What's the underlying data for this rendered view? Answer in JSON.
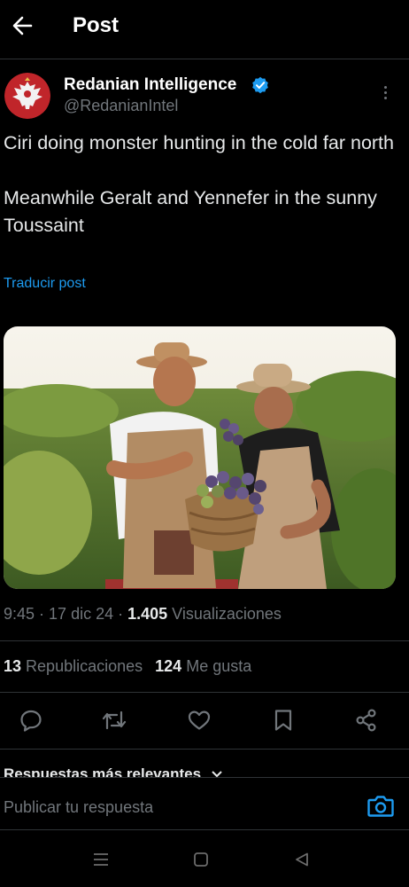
{
  "header": {
    "title": "Post",
    "back_icon": "arrow-left-icon"
  },
  "author": {
    "display_name": "Redanian Intelligence",
    "handle": "@RedanianIntel",
    "verified": true,
    "verified_color": "#1d9bf0",
    "avatar_icon": "eagle-crest-icon"
  },
  "post": {
    "paragraphs": [
      "Ciri doing monster hunting in the cold far north",
      "Meanwhile Geralt and Yennefer in the sunny Toussaint"
    ],
    "translate_label": "Traducir post",
    "image_icon": "photo-couple-with-grapes"
  },
  "meta": {
    "time": "9:45",
    "date": "17 dic 24",
    "views_count": "1.405",
    "views_label": "Visualizaciones"
  },
  "stats": {
    "reposts_count": "13",
    "reposts_label": "Republicaciones",
    "likes_count": "124",
    "likes_label": "Me gusta"
  },
  "actions": [
    "reply-icon",
    "repost-icon",
    "like-icon",
    "bookmark-icon",
    "share-icon"
  ],
  "replies_header": "Respuestas más relevantes",
  "reply_bar": {
    "placeholder": "Publicar tu respuesta",
    "camera_icon": "camera-icon"
  },
  "system_nav": [
    "recent-apps-icon",
    "home-icon",
    "back-triangle-icon"
  ],
  "colors": {
    "background": "#000000",
    "text": "#e7e9ea",
    "muted": "#71767b",
    "accent": "#1d9bf0",
    "divider": "#2f3336"
  }
}
